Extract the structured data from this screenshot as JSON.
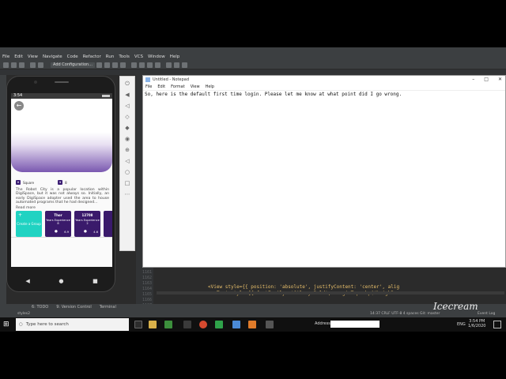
{
  "ide": {
    "menus": [
      "File",
      "Edit",
      "View",
      "Navigate",
      "Code",
      "Refactor",
      "Run",
      "Tools",
      "VCS",
      "Window",
      "Help"
    ],
    "add_configuration": "Add Configuration...",
    "bottom_tabs": [
      "6: TODO",
      "9: Version Control",
      "Terminal"
    ],
    "status_left": "Event Log",
    "status_right": "14:37  CRLF  UTF-8  4 spaces  Git: master",
    "tab_name": "styles2",
    "line_numbers": [
      "1160",
      "1161",
      "1162",
      "1163",
      "1164",
      "1165",
      "1166",
      "1167"
    ],
    "code_lines": [
      {
        "indent": "            ",
        "text": "<View style={{ position: 'absolute', justifyContent: 'center', alig"
      },
      {
        "indent": "              ",
        "text": "<Text style={{ fontFamily: 'Gilroy-Bold', marginTop: hp('heighP"
      }
    ]
  },
  "emulator": {
    "status_time": "3:54",
    "stat_1": "Square",
    "stat_2": "8",
    "description": "The Robot City is a popular location within DigiSpace, but it was not always so. Initially, an early DigiSpace adopter used the area to house automated programs that he had designed...",
    "read_more": "Read more",
    "cards": [
      {
        "kind": "create",
        "label": "Create a Group"
      },
      {
        "kind": "group",
        "title": "Thor",
        "sub": "Years Experience 8",
        "count": "6.9"
      },
      {
        "kind": "group",
        "title": "12708",
        "sub": "Years Experience 2",
        "count": "4.6"
      },
      {
        "kind": "group",
        "title": "",
        "sub": "Ex",
        "count": ""
      }
    ]
  },
  "notepad": {
    "title": "Untitled - Notepad",
    "menus": [
      "File",
      "Edit",
      "Format",
      "View",
      "Help"
    ],
    "text": "So, here is the default first time login. Please let me know at what point did I go wrong."
  },
  "taskbar": {
    "search_placeholder": "Type here to search",
    "address_label": "Address",
    "language": "ENG",
    "time": "3:54 PM",
    "date": "1/6/2020"
  },
  "watermark": "Icecream"
}
